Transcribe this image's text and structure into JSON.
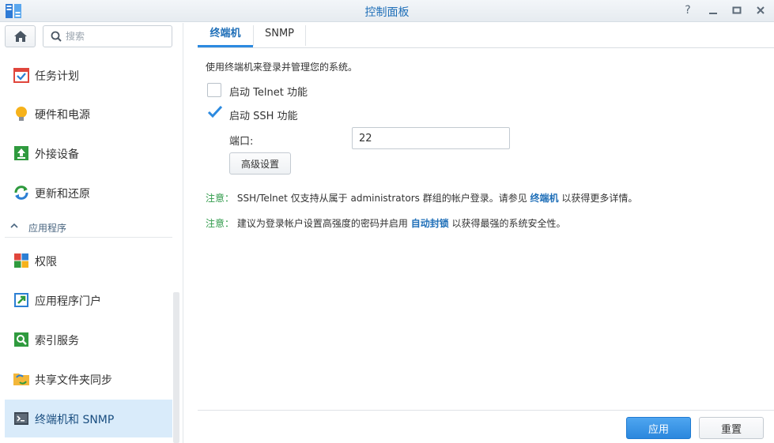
{
  "window": {
    "title": "控制面板",
    "help_icon": "question-icon",
    "controls": [
      "minimize-icon",
      "maximize-icon",
      "close-icon"
    ]
  },
  "sidebar": {
    "search_placeholder": "搜索",
    "items_top": [
      {
        "label": "任务计划",
        "icon": "task-scheduler-icon"
      },
      {
        "label": "硬件和电源",
        "icon": "lightbulb-icon"
      },
      {
        "label": "外接设备",
        "icon": "external-device-icon"
      },
      {
        "label": "更新和还原",
        "icon": "update-restore-icon"
      }
    ],
    "section": "应用程序",
    "items_apps": [
      {
        "label": "权限",
        "icon": "privileges-icon"
      },
      {
        "label": "应用程序门户",
        "icon": "app-portal-icon"
      },
      {
        "label": "索引服务",
        "icon": "indexing-icon"
      },
      {
        "label": "共享文件夹同步",
        "icon": "folder-sync-icon"
      },
      {
        "label": "终端机和 SNMP",
        "icon": "terminal-icon",
        "active": true
      }
    ]
  },
  "tabs": [
    {
      "label": "终端机",
      "active": true
    },
    {
      "label": "SNMP",
      "active": false
    }
  ],
  "main": {
    "description": "使用终端机来登录并管理您的系统。",
    "telnet": {
      "label": "启动 Telnet 功能",
      "checked": false
    },
    "ssh": {
      "label": "启动 SSH 功能",
      "checked": true
    },
    "port_label": "端口:",
    "port_value": "22",
    "advanced_button": "高级设置",
    "note1": {
      "prefix": "注意：",
      "text_before": "SSH/Telnet 仅支持从属于 administrators 群组的帐户登录。请参见",
      "link": "终端机",
      "text_after": "以获得更多详情。"
    },
    "note2": {
      "prefix": "注意：",
      "text_before": "建议为登录帐户设置高强度的密码并启用",
      "link": "自动封锁",
      "text_after": "以获得最强的系统安全性。"
    }
  },
  "footer": {
    "apply": "应用",
    "reset": "重置"
  },
  "colors": {
    "accent": "#1f6fb8",
    "note_green": "#2f9a4a",
    "active_item_bg": "#d9ebfa",
    "apply_bg": "#2b87dd"
  }
}
